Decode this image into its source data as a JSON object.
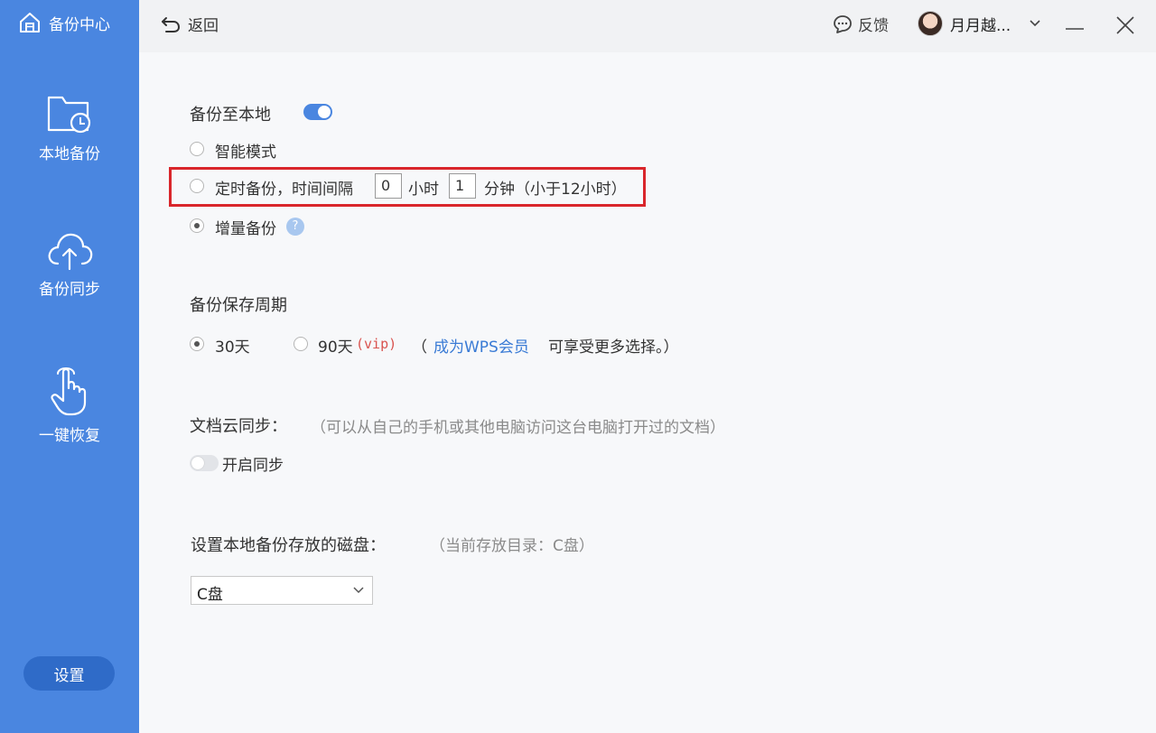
{
  "sidebar": {
    "brand": "备份中心",
    "items": [
      {
        "label": "本地备份",
        "icon": "folder-clock-icon"
      },
      {
        "label": "备份同步",
        "icon": "cloud-upload-icon"
      },
      {
        "label": "一键恢复",
        "icon": "hand-pointer-icon"
      }
    ],
    "settings_label": "设置"
  },
  "topbar": {
    "back_label": "返回",
    "feedback_label": "反馈",
    "user_name": "月月越..."
  },
  "backup_local": {
    "title": "备份至本地",
    "enabled": true,
    "options": {
      "smart": "智能模式",
      "timed_prefix": "定时备份，时间间隔",
      "hours_value": "0",
      "hours_unit": "小时",
      "minutes_value": "1",
      "minutes_unit": "分钟（小于12小时）",
      "incremental": "增量备份",
      "help_glyph": "?"
    },
    "selected": "incremental"
  },
  "retention": {
    "title": "备份保存周期",
    "opt30": "30天",
    "opt90": "90天",
    "vip_tag": "(vip)",
    "note_open": "（",
    "note_link": "成为WPS会员",
    "note_rest": "可享受更多选择。）",
    "selected": "30天"
  },
  "cloud_sync": {
    "title": "文档云同步：",
    "desc": "（可以从自己的手机或其他电脑访问这台电脑打开过的文档）",
    "toggle_label": "开启同步",
    "enabled": false
  },
  "disk": {
    "title": "设置本地备份存放的磁盘：",
    "current": "（当前存放目录：C盘）",
    "selected": "C盘"
  },
  "colors": {
    "sidebar": "#4a86e0",
    "accent": "#4a86e0",
    "highlight_border": "#d9262b",
    "link": "#3a7bd5",
    "vip": "#d9534f"
  }
}
